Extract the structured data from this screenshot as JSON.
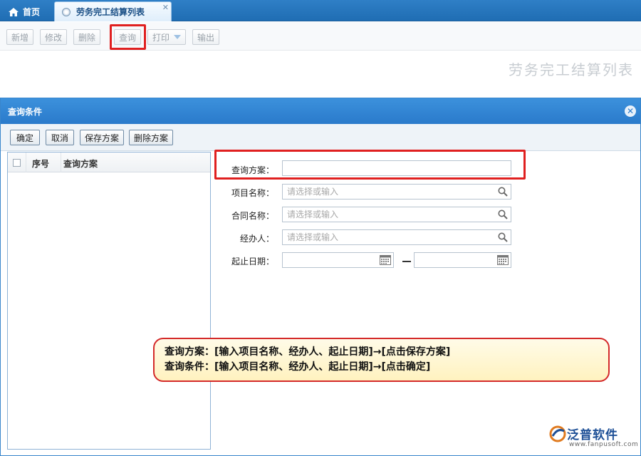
{
  "tabs": {
    "home_label": "首页",
    "active_label": "劳务完工结算列表",
    "close_glyph": "✕"
  },
  "toolbar": {
    "add_label": "新增",
    "edit_label": "修改",
    "delete_label": "删除",
    "query_label": "查询",
    "print_label": "打印",
    "export_label": "输出"
  },
  "page_title": "劳务完工结算列表",
  "dialog": {
    "title": "查询条件",
    "close_glyph": "✕",
    "buttons": {
      "ok": "确定",
      "cancel": "取消",
      "save_scheme": "保存方案",
      "delete_scheme": "删除方案"
    },
    "list": {
      "col_seq": "序号",
      "col_name": "查询方案"
    },
    "form": {
      "scheme_label": "查询方案：",
      "scheme_value": "",
      "project_label": "项目名称：",
      "project_placeholder": "请选择或输入",
      "contract_label": "合同名称：",
      "contract_placeholder": "请选择或输入",
      "handler_label": "经办人：",
      "handler_placeholder": "请选择或输入",
      "date_label": "起止日期：",
      "date_start": "",
      "date_end": ""
    }
  },
  "note": {
    "line1": "查询方案：[输入项目名称、经办人、起止日期]→[点击保存方案]",
    "line2": "查询条件：[输入项目名称、经办人、起止日期]→[点击确定]"
  },
  "brand": {
    "name": "泛普软件",
    "url": "www.fanpusoft.com"
  },
  "colors": {
    "accent": "#2a7acb",
    "highlight": "#e02020",
    "note_bg": "#fff2bf"
  }
}
